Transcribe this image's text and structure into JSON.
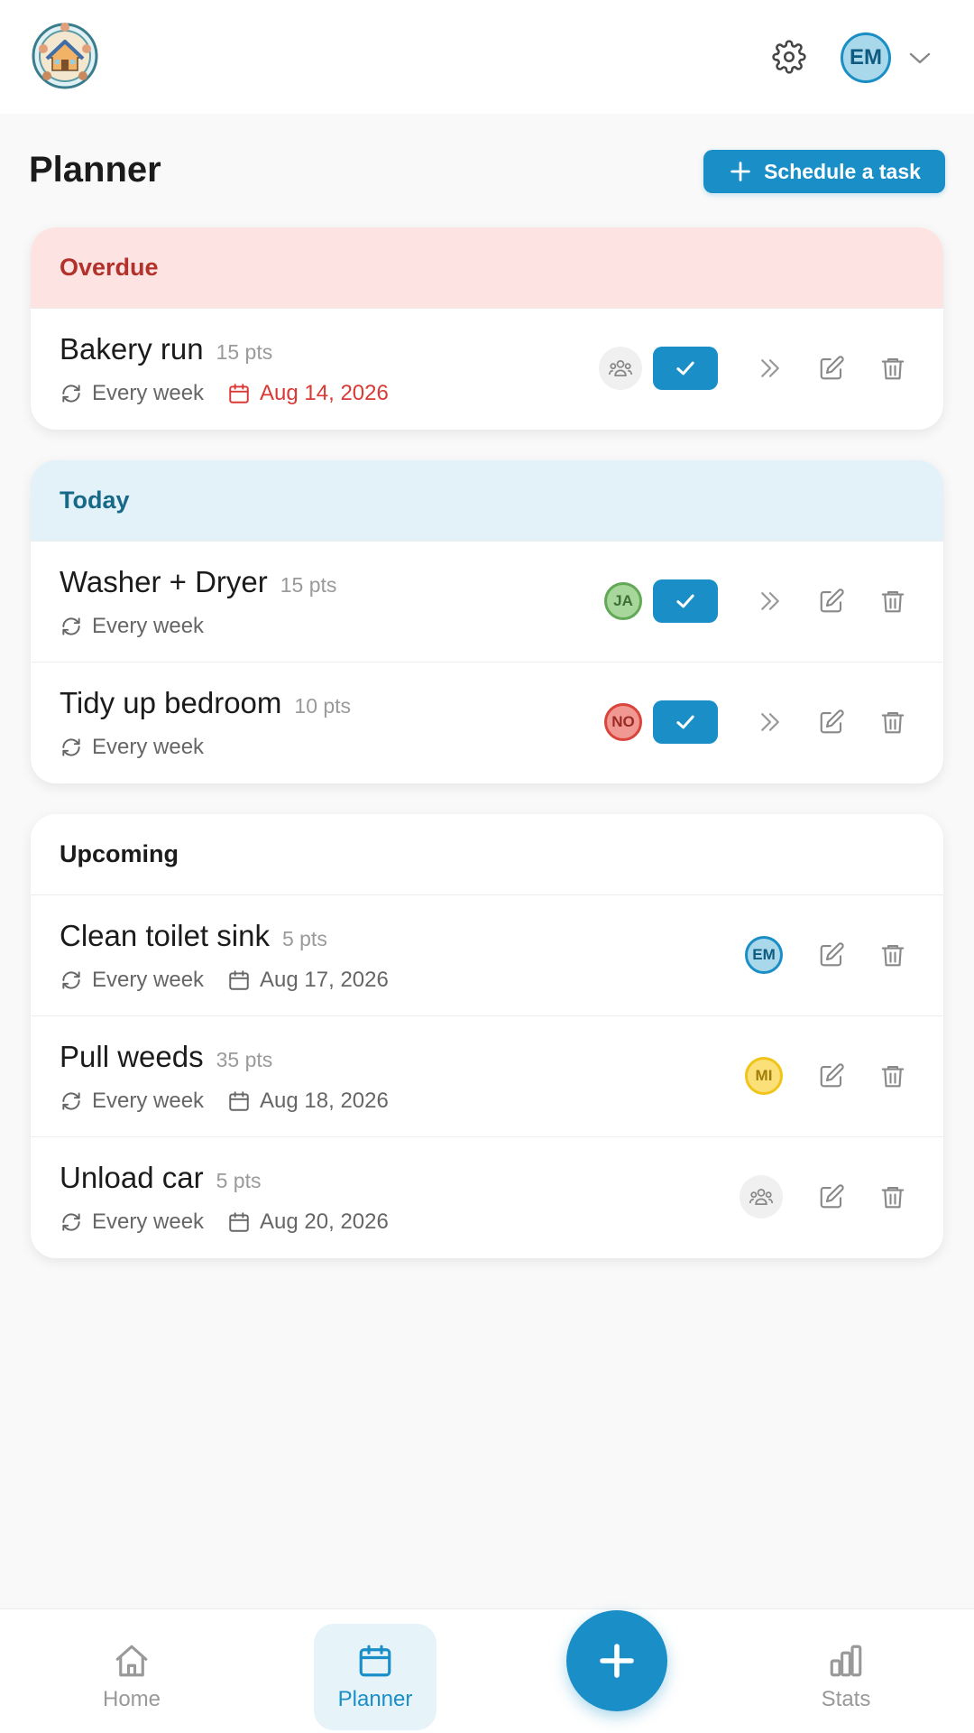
{
  "header": {
    "logo_icon": "house-family-logo-icon",
    "settings_icon": "gear-icon",
    "user_initials": "EM",
    "menu_icon": "chevron-down-icon"
  },
  "page": {
    "title": "Planner",
    "schedule_button": "Schedule a task"
  },
  "colors": {
    "accent": "#1a8ec6",
    "overdue": "#d93a35",
    "overdue_bg": "#fde3e2",
    "today_bg": "#e3f1f8"
  },
  "sections": {
    "overdue": {
      "label": "Overdue",
      "tasks": [
        {
          "title": "Bakery run",
          "pts": "15 pts",
          "recurrence": "Every week",
          "date": "Aug 14, 2026",
          "assignee": "group"
        }
      ]
    },
    "today": {
      "label": "Today",
      "tasks": [
        {
          "title": "Washer + Dryer",
          "pts": "15 pts",
          "recurrence": "Every week",
          "assignee": "JA"
        },
        {
          "title": "Tidy up bedroom",
          "pts": "10 pts",
          "recurrence": "Every week",
          "assignee": "NO"
        }
      ]
    },
    "upcoming": {
      "label": "Upcoming",
      "tasks": [
        {
          "title": "Clean toilet sink",
          "pts": "5 pts",
          "recurrence": "Every week",
          "date": "Aug 17, 2026",
          "assignee": "EM"
        },
        {
          "title": "Pull weeds",
          "pts": "35 pts",
          "recurrence": "Every week",
          "date": "Aug 18, 2026",
          "assignee": "MI"
        },
        {
          "title": "Unload car",
          "pts": "5 pts",
          "recurrence": "Every week",
          "date": "Aug 20, 2026",
          "assignee": "group"
        }
      ]
    }
  },
  "nav": {
    "home": "Home",
    "planner": "Planner",
    "stats": "Stats",
    "fab_icon": "plus-icon"
  }
}
